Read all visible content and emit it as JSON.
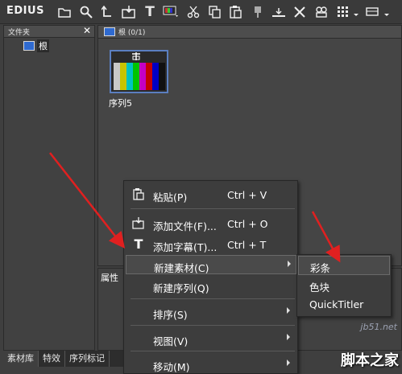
{
  "toolbar": {
    "app_name": "EDIUS",
    "buttons": [
      "folder-icon",
      "search-icon",
      "up-icon",
      "import-icon",
      "title-icon",
      "monitor-icon",
      "cut-icon",
      "copy-icon",
      "paste-icon",
      "marker-icon",
      "trim-icon",
      "delete-icon",
      "properties-icon",
      "grid-view-icon",
      "menu-chevron-icon"
    ]
  },
  "folder_panel": {
    "title": "文件夹",
    "close": "✕",
    "root_label": "根"
  },
  "bin": {
    "title": "根 (0/1)",
    "clip": {
      "name": "序列5",
      "bar_colors": [
        "#c9c9c9",
        "#c9c400",
        "#00c2c2",
        "#00c400",
        "#c400c4",
        "#c40000",
        "#0000c4",
        "#101010"
      ]
    }
  },
  "properties": {
    "title": "属性"
  },
  "tabs": [
    "素材库",
    "特效",
    "序列标记"
  ],
  "context_menu": {
    "items": [
      {
        "label": "粘贴(P)",
        "shortcut": "Ctrl + V",
        "icon": "paste-icon"
      },
      {
        "label": "添加文件(F)...",
        "shortcut": "Ctrl + O",
        "icon": "add-file-icon"
      },
      {
        "label": "添加字幕(T)...",
        "shortcut": "Ctrl + T",
        "icon": "title-icon"
      },
      {
        "label": "新建素材(C)",
        "shortcut": "",
        "submenu": true
      },
      {
        "label": "新建序列(Q)",
        "shortcut": ""
      },
      {
        "label": "排序(S)",
        "shortcut": "",
        "submenu": true
      },
      {
        "label": "视图(V)",
        "shortcut": "",
        "submenu": true
      },
      {
        "label": "移动(M)",
        "shortcut": "",
        "submenu": true
      }
    ]
  },
  "submenu": {
    "items": [
      "彩条",
      "色块",
      "QuickTitler"
    ]
  },
  "watermark": {
    "top": "jb51.net",
    "bottom": "脚本之家"
  },
  "colors": {
    "arrow": "#e02020",
    "highlight_border": "#6a6a6a",
    "selection": "#5b7fc0"
  }
}
